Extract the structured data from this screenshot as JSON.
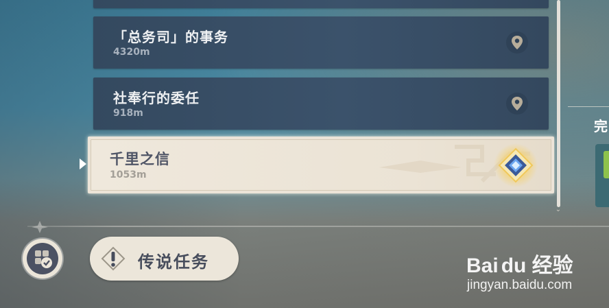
{
  "quest_list": {
    "items": [
      {
        "title": "「总务司」的事务",
        "distance": "4320m"
      },
      {
        "title": "社奉行的委任",
        "distance": "918m"
      }
    ],
    "selected": {
      "title": "千里之信",
      "distance": "1053m"
    }
  },
  "side_panel": {
    "partial_text": "完"
  },
  "footer": {
    "legend_button_label": "传说任务"
  },
  "watermark": {
    "logo": "Bai du 经验",
    "url": "jingyan.baidu.com"
  },
  "colors": {
    "row_bg": "#3b526b",
    "selected_bg": "#ece4d8",
    "title_text": "#eef0f2",
    "selected_title": "#4f5566",
    "accent_diamond": "#4a7fd6"
  },
  "icons": {
    "row_pin": "map-pin-icon",
    "selected_marker": "diamond-quest-icon",
    "legend": "exclamation-diamond-icon",
    "round_button": "quest-checklist-icon"
  }
}
